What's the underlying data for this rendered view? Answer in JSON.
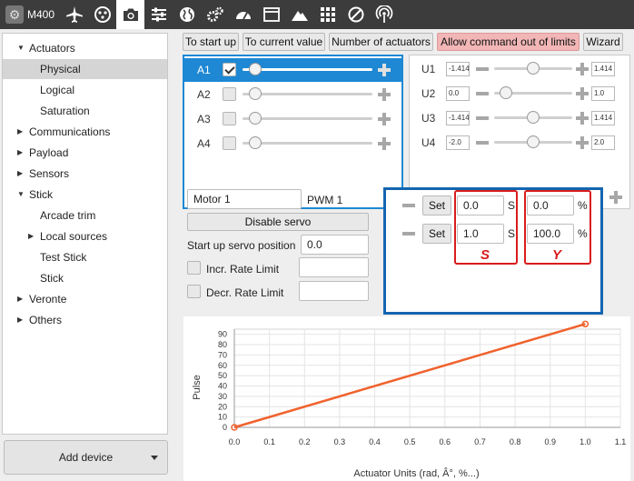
{
  "topbar": {
    "device_name": "M400",
    "tools": [
      {
        "icon": "airplane-icon",
        "active": false
      },
      {
        "icon": "joystick-icon",
        "active": false
      },
      {
        "icon": "camera-icon",
        "active": true
      },
      {
        "icon": "sliders-icon",
        "active": false
      },
      {
        "icon": "globe-icon",
        "active": false
      },
      {
        "icon": "gears-icon",
        "active": false
      },
      {
        "icon": "gauge-icon",
        "active": false
      },
      {
        "icon": "window-icon",
        "active": false
      },
      {
        "icon": "mountain-icon",
        "active": false
      },
      {
        "icon": "grid-icon",
        "active": false
      },
      {
        "icon": "prohibit-icon",
        "active": false
      },
      {
        "icon": "antenna-icon",
        "active": false
      }
    ]
  },
  "sidebar": {
    "items": [
      {
        "label": "Actuators",
        "indent": 1,
        "arrow": "down"
      },
      {
        "label": "Physical",
        "indent": 2,
        "selected": true
      },
      {
        "label": "Logical",
        "indent": 2
      },
      {
        "label": "Saturation",
        "indent": 2
      },
      {
        "label": "Communications",
        "indent": 1,
        "arrow": "right"
      },
      {
        "label": "Payload",
        "indent": 1,
        "arrow": "right"
      },
      {
        "label": "Sensors",
        "indent": 1,
        "arrow": "right"
      },
      {
        "label": "Stick",
        "indent": 1,
        "arrow": "down"
      },
      {
        "label": "Arcade trim",
        "indent": 2
      },
      {
        "label": "Local sources",
        "indent": 2,
        "arrow": "right"
      },
      {
        "label": "Test Stick",
        "indent": 2
      },
      {
        "label": "Stick",
        "indent": 2
      },
      {
        "label": "Veronte",
        "indent": 1,
        "arrow": "right"
      },
      {
        "label": "Others",
        "indent": 1,
        "arrow": "right"
      }
    ],
    "add_device_label": "Add device"
  },
  "actions": {
    "to_start_up": "To start up",
    "to_current_value": "To current value",
    "number_of_actuators": "Number of actuators",
    "allow_command": "Allow command out of limits",
    "wizard": "Wizard"
  },
  "actuators": [
    {
      "label": "A1",
      "checked": true,
      "selected": true,
      "value": 0.1
    },
    {
      "label": "A2",
      "checked": false,
      "selected": false,
      "value": 0.1
    },
    {
      "label": "A3",
      "checked": false,
      "selected": false,
      "value": 0.1
    },
    {
      "label": "A4",
      "checked": false,
      "selected": false,
      "value": 0.1
    }
  ],
  "u_controls": [
    {
      "label": "U1",
      "min": "-1.414",
      "max": "1.414",
      "value": 0.5
    },
    {
      "label": "U2",
      "min": "0.0",
      "max": "1.0",
      "value": 0.15
    },
    {
      "label": "U3",
      "min": "-1.414",
      "max": "1.414",
      "value": 0.5
    },
    {
      "label": "U4",
      "min": "-2.0",
      "max": "2.0",
      "value": 0.5
    }
  ],
  "servo": {
    "name": "Motor 1",
    "output": "PWM 1",
    "disable_label": "Disable servo",
    "startup_label": "Start up servo position",
    "startup_value": "0.0",
    "incr_label": "Incr. Rate Limit",
    "incr_value": "",
    "decr_label": "Decr. Rate Limit",
    "decr_value": ""
  },
  "pwm_rows": [
    {
      "set_label": "Set",
      "s_value": "0.0",
      "s_unit": "S",
      "y_value": "0.0",
      "y_unit": "%"
    },
    {
      "set_label": "Set",
      "s_value": "1.0",
      "s_unit": "S",
      "y_value": "100.0",
      "y_unit": "%"
    }
  ],
  "annotations": {
    "s": "S",
    "y": "Y"
  },
  "colors": {
    "accent": "#1e88d4",
    "annotation": "#d91c1c",
    "line": "#f0622e"
  },
  "chart_data": {
    "type": "line",
    "xlabel": "Actuator Units (rad, Â°, %...)",
    "ylabel": "Pulse",
    "xlim": [
      0.0,
      1.1
    ],
    "ylim": [
      0,
      95
    ],
    "xticks": [
      "0.0",
      "0.1",
      "0.2",
      "0.3",
      "0.4",
      "0.5",
      "0.6",
      "0.7",
      "0.8",
      "0.9",
      "1.0",
      "1.1"
    ],
    "yticks": [
      "0",
      "10",
      "20",
      "30",
      "40",
      "50",
      "60",
      "70",
      "80",
      "90"
    ],
    "grid": true,
    "series": [
      {
        "x": [
          0.0,
          1.0
        ],
        "y": [
          0,
          100
        ]
      }
    ]
  }
}
